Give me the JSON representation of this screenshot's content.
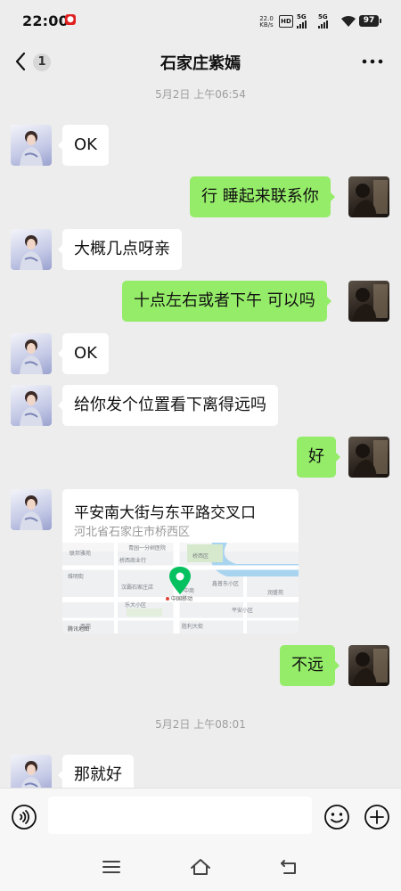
{
  "status_bar": {
    "time": "22:00",
    "notification_icon": "weibo-notification-icon",
    "net_speed_value": "22.0",
    "net_speed_unit": "KB/s",
    "hd_label": "HD",
    "sim1_label": "5G",
    "sim2_label": "5G",
    "battery": "97"
  },
  "header": {
    "back_icon": "chevron-left-icon",
    "unread_count": "1",
    "title": "石家庄紫嫣",
    "more_icon": "more-dots-icon"
  },
  "messages": {
    "ts1": "5月2日 上午06:54",
    "m1": "OK",
    "m2": "行 睡起来联系你",
    "m3": "大概几点呀亲",
    "m4": "十点左右或者下午 可以吗",
    "m5": "OK",
    "m6": "给你发个位置看下离得远吗",
    "m7": "好",
    "location": {
      "title": "平安南大街与东平路交叉口",
      "address": "河北省石家庄市桥西区",
      "map_labels": {
        "l1": "青园一分树医院",
        "l2": "桥西区",
        "l3": "桥西商业行",
        "l4": "联邦雅苑",
        "l5": "维明街",
        "l6": "鑫普东小区",
        "l7": "中国移动",
        "l8": "中商",
        "l9": "汉霸石家庄店",
        "l10": "乐大小区",
        "l11": "平安小区",
        "l12": "胜利大街",
        "l13": "西苑",
        "l14": "润盛苑",
        "watermark": "腾讯地图"
      }
    },
    "m8": "不远",
    "ts2": "5月2日 上午08:01",
    "m9": "那就好"
  },
  "input_bar": {
    "voice_icon": "voice-input-icon",
    "placeholder": "",
    "emoji_icon": "emoji-icon",
    "plus_icon": "plus-icon"
  },
  "system_nav": {
    "menu_icon": "menu-icon",
    "home_icon": "home-icon",
    "back_icon": "back-icon"
  },
  "colors": {
    "background": "#EDEDED",
    "my_bubble": "#95EC69",
    "their_bubble": "#FFFFFF",
    "map_pin": "#07C160"
  }
}
